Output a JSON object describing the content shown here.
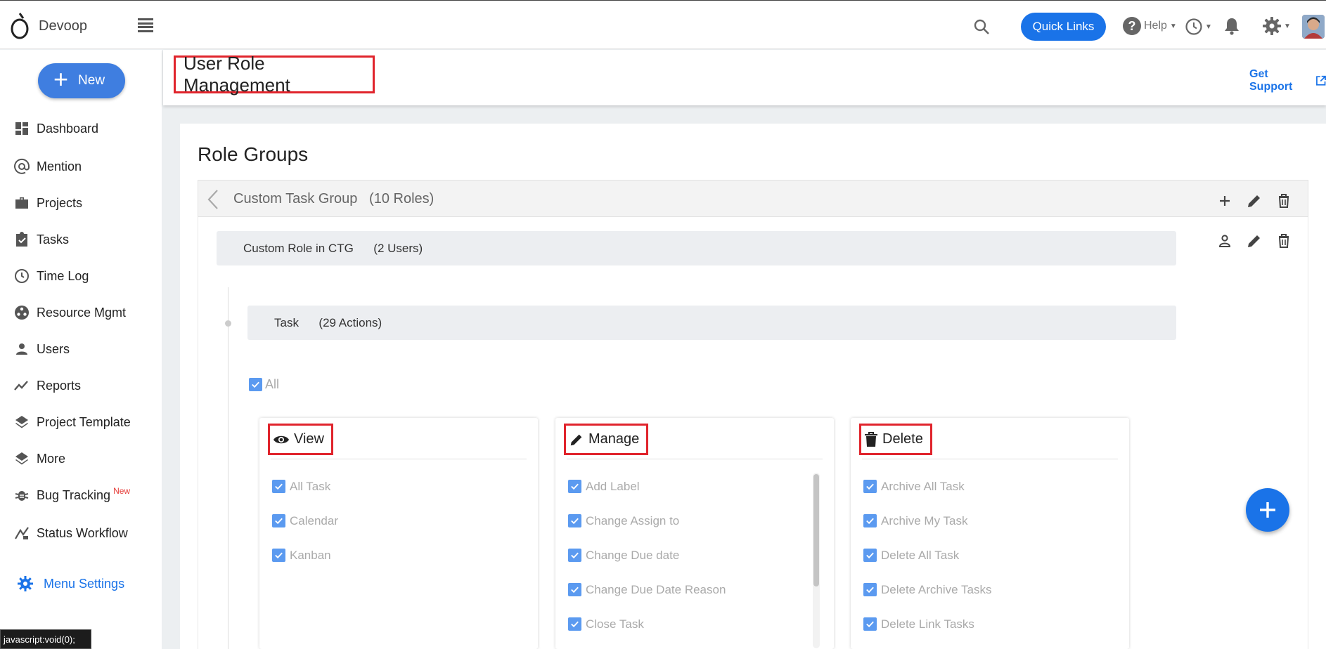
{
  "app": {
    "brand": "Devoop"
  },
  "topbar": {
    "quick_links": "Quick Links",
    "help": "Help"
  },
  "sidebar": {
    "new_label": "New",
    "items": [
      {
        "label": "Dashboard",
        "icon": "dashboard-icon"
      },
      {
        "label": "Mention",
        "icon": "at-icon"
      },
      {
        "label": "Projects",
        "icon": "briefcase-icon"
      },
      {
        "label": "Tasks",
        "icon": "clipboard-check-icon"
      },
      {
        "label": "Time Log",
        "icon": "clock-icon"
      },
      {
        "label": "Resource Mgmt",
        "icon": "resource-icon"
      },
      {
        "label": "Users",
        "icon": "person-icon"
      },
      {
        "label": "Reports",
        "icon": "trend-icon"
      },
      {
        "label": "Project Template",
        "icon": "layers-icon"
      },
      {
        "label": "More",
        "icon": "layers-icon"
      },
      {
        "label": "Bug Tracking",
        "icon": "bug-icon",
        "badge": "New"
      },
      {
        "label": "Status Workflow",
        "icon": "workflow-icon"
      }
    ],
    "menu_settings": "Menu Settings",
    "status_tip": "javascript:void(0);"
  },
  "header": {
    "title": "User Role Management",
    "get_support": "Get Support"
  },
  "main": {
    "section_title": "Role Groups",
    "group": {
      "name": "Custom Task Group",
      "count": "(10 Roles)"
    },
    "role": {
      "name": "Custom Role in CTG",
      "count": "(2 Users)"
    },
    "module": {
      "name": "Task",
      "count": "(29 Actions)"
    },
    "all_label": "All",
    "perm_cards": [
      {
        "title": "View",
        "icon": "eye-icon",
        "items": [
          "All Task",
          "Calendar",
          "Kanban"
        ]
      },
      {
        "title": "Manage",
        "icon": "pencil-icon",
        "items": [
          "Add Label",
          "Change Assign to",
          "Change Due date",
          "Change Due Date Reason",
          "Close Task"
        ]
      },
      {
        "title": "Delete",
        "icon": "trash-icon",
        "items": [
          "Archive All Task",
          "Archive My Task",
          "Delete All Task",
          "Delete Archive Tasks",
          "Delete Link Tasks"
        ]
      }
    ]
  },
  "colors": {
    "accent": "#1a73e8",
    "highlight_border": "#e0242c",
    "checkbox": "#5b9af0"
  }
}
